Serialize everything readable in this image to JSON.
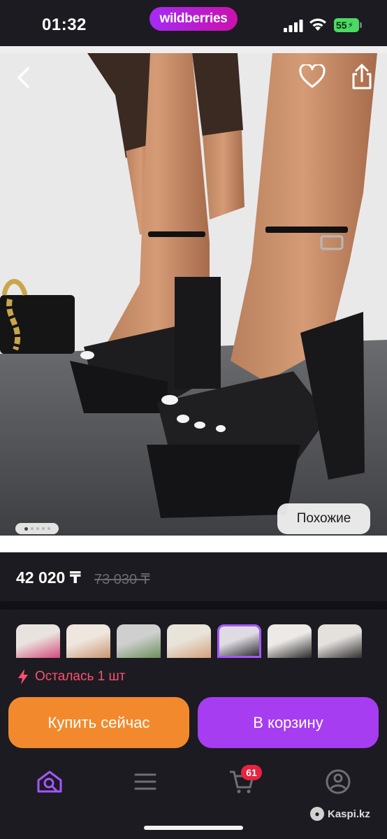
{
  "status_bar": {
    "time": "01:32",
    "brand": "wildberries",
    "battery": "55"
  },
  "product": {
    "price": "42 020 ₸",
    "old_price": "73 030 ₸",
    "stock_text": "Осталась 1 шт",
    "similar_label": "Похожие",
    "gallery_total": 5,
    "gallery_active": 1
  },
  "actions": {
    "buy_now": "Купить сейчас",
    "add_to_cart": "В корзину"
  },
  "thumbnails": [
    {
      "name": "thumb-1",
      "selected": false
    },
    {
      "name": "thumb-2",
      "selected": false
    },
    {
      "name": "thumb-3",
      "selected": false
    },
    {
      "name": "thumb-4",
      "selected": false
    },
    {
      "name": "thumb-5",
      "selected": true
    },
    {
      "name": "thumb-6",
      "selected": false
    },
    {
      "name": "thumb-7",
      "selected": false
    }
  ],
  "tab_bar": {
    "items": [
      {
        "icon": "home-search-icon",
        "active": true
      },
      {
        "icon": "menu-icon",
        "active": false
      },
      {
        "icon": "cart-icon",
        "active": false
      },
      {
        "icon": "profile-icon",
        "active": false
      }
    ],
    "cart_badge": "61"
  },
  "watermark": "Kaspi.kz",
  "colors": {
    "brand_gradient_start": "#a52bf5",
    "brand_gradient_end": "#cb11ab",
    "buy_button": "#f28a2d",
    "cart_button": "#a63df0",
    "stock_warning": "#ff4f72",
    "badge": "#e8233f",
    "background": "#1c1b21"
  }
}
